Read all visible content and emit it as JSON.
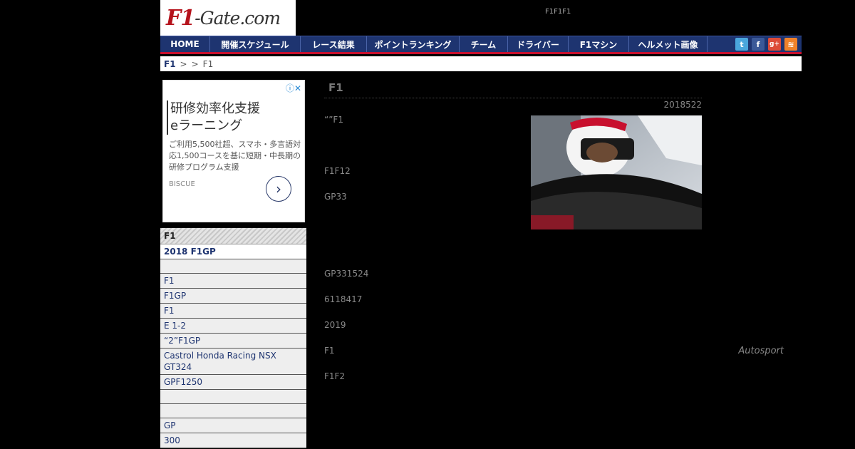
{
  "header": {
    "logo_main": "F1",
    "logo_sub": "-Gate.com",
    "top_text": "F1F1F1"
  },
  "nav": {
    "items": [
      {
        "label": "HOME"
      },
      {
        "label": "開催スケジュール"
      },
      {
        "label": "レース結果"
      },
      {
        "label": "ポイントランキング"
      },
      {
        "label": "チーム"
      },
      {
        "label": "ドライバー"
      },
      {
        "label": "F1マシン"
      },
      {
        "label": "ヘルメット画像"
      }
    ],
    "icons": [
      {
        "name": "twitter-icon",
        "glyph": "t",
        "color": "#4aa6dd"
      },
      {
        "name": "facebook-icon",
        "glyph": "f",
        "color": "#3b5998"
      },
      {
        "name": "google-plus-icon",
        "glyph": "g+",
        "color": "#dd4b39"
      },
      {
        "name": "rss-icon",
        "glyph": "≋",
        "color": "#f0822a"
      }
    ]
  },
  "breadcrumb": {
    "home": "F1",
    "sep1": ">",
    "sep2": ">",
    "current": "F1"
  },
  "ad": {
    "info_icon": "ⓘ✕",
    "headline_1": "研修効率化支援",
    "headline_2": "eラーニング",
    "description": "ご利用5,500社超、スマホ・多言語対応1,500コースを基に短期・中長期の研修プログラム支援",
    "brand": "BISCUE",
    "arrow": "›"
  },
  "sidebar": {
    "header": "F1",
    "items": [
      {
        "label": "2018 F1GP",
        "bold": true
      },
      {
        "label": ""
      },
      {
        "label": "F1"
      },
      {
        "label": "F1GP"
      },
      {
        "label": " F1"
      },
      {
        "label": "E 1-2"
      },
      {
        "label": "“2”F1GP"
      },
      {
        "label": "Castrol Honda Racing NSX GT324"
      },
      {
        "label": "GPF1250"
      },
      {
        "label": ""
      },
      {
        "label": ""
      },
      {
        "label": " GP"
      },
      {
        "label": "300"
      }
    ]
  },
  "article": {
    "title": "F1",
    "date": "2018522",
    "paragraphs": [
      {
        "text": "“”F1",
        "top": 0
      },
      {
        "text": "F1F12",
        "top": 0
      },
      {
        "text": "GP33",
        "top": 0
      },
      {
        "text": "GP331524",
        "top": 0
      },
      {
        "text": "6118417",
        "top": 0
      },
      {
        "text": "2019",
        "top": 0
      },
      {
        "text": "F1",
        "top": 0
      },
      {
        "text": "F1F2",
        "top": 0
      }
    ],
    "photo_credit": "Autosport"
  }
}
